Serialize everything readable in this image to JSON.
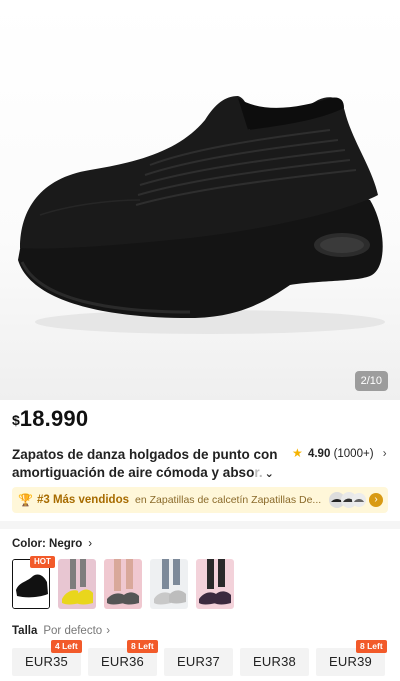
{
  "gallery": {
    "counter": "2/10"
  },
  "product": {
    "currency": "$",
    "price": "18.990",
    "title_line1": "Zapatos de danza holgados de punto con",
    "title_line2_visible": "amortiguación de aire cómoda y abso",
    "title_line2_fade": "r.",
    "rating_score": "4.90",
    "rating_count": "(1000+)"
  },
  "ranking": {
    "rank": "#3 Más vendidos",
    "category": "en Zapatillas de calcetín Zapatillas De..."
  },
  "color": {
    "label": "Color: Negro",
    "hot_badge": "HOT",
    "swatches": [
      "black-knit",
      "yellow",
      "gray-pink",
      "silver",
      "purple-black"
    ]
  },
  "size": {
    "label": "Talla",
    "default": "Por defecto",
    "options": [
      {
        "label": "EUR35",
        "badge": "4 Left"
      },
      {
        "label": "EUR36",
        "badge": "8 Left"
      },
      {
        "label": "EUR37",
        "badge": ""
      },
      {
        "label": "EUR38",
        "badge": ""
      },
      {
        "label": "EUR39",
        "badge": "8 Left"
      }
    ]
  },
  "colors": {
    "accent": "#f25a2a",
    "rank_bg": "#fff7d9",
    "star": "#f5b301"
  }
}
